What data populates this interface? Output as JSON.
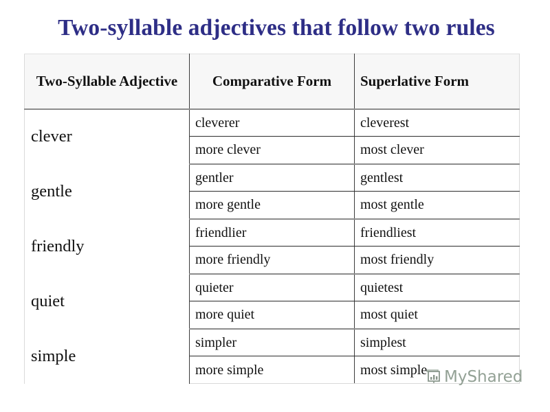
{
  "slide": {
    "title": "Two-syllable adjectives that follow two rules",
    "title_color": "#2e2e86",
    "background_color": "#ffffff"
  },
  "table": {
    "headers": {
      "adjective": "Two-Syllable Adjective",
      "comparative": "Comparative Form",
      "superlative": "Superlative Form"
    },
    "header_background": "#f7f7f7",
    "rows": [
      {
        "adjective": "clever",
        "comparative_ending": "cleverer",
        "superlative_ending": "cleverest",
        "comparative_more": "more clever",
        "superlative_most": "most clever"
      },
      {
        "adjective": "gentle",
        "comparative_ending": "gentler",
        "superlative_ending": "gentlest",
        "comparative_more": "more gentle",
        "superlative_most": "most gentle"
      },
      {
        "adjective": "friendly",
        "comparative_ending": "friendlier",
        "superlative_ending": "friendliest",
        "comparative_more": "more friendly",
        "superlative_most": "most friendly"
      },
      {
        "adjective": "quiet",
        "comparative_ending": "quieter",
        "superlative_ending": "quietest",
        "comparative_more": "more quiet",
        "superlative_most": "most quiet"
      },
      {
        "adjective": "simple",
        "comparative_ending": "simpler",
        "superlative_ending": "simplest",
        "comparative_more": "more simple",
        "superlative_most": "most simple"
      }
    ]
  },
  "watermark": {
    "text": "MyShared",
    "icon": "presentation-chart-icon",
    "color": "#8a9a8d"
  }
}
